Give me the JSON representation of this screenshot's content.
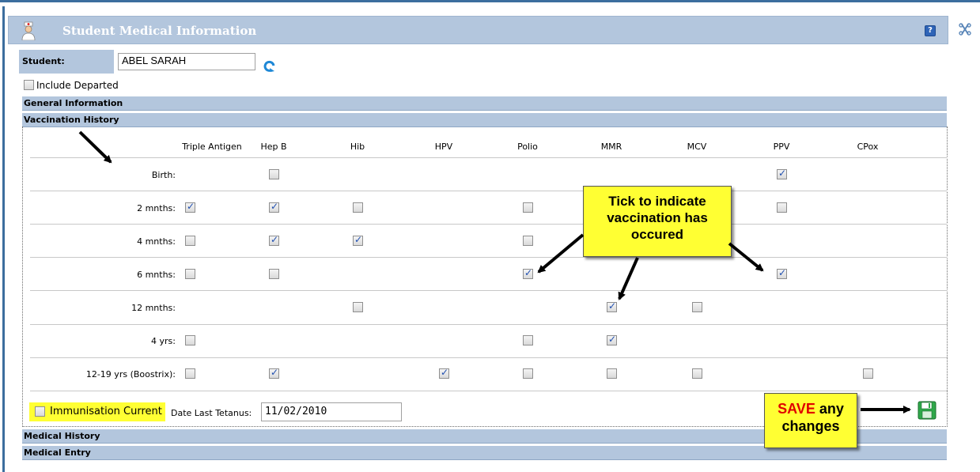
{
  "window": {
    "title": "Student Medical Information",
    "help_label": "?"
  },
  "student": {
    "label": "Student:",
    "value": "ABEL SARAH"
  },
  "include_departed": {
    "label": "Include Departed",
    "checked": false
  },
  "sections": {
    "general": "General Information",
    "vaccination": "Vaccination History",
    "medical_history": "Medical History",
    "medical_entry": "Medical Entry"
  },
  "columns": [
    "Triple Antigen",
    "Hep B",
    "Hib",
    "HPV",
    "Polio",
    "MMR",
    "MCV",
    "PPV",
    "CPox"
  ],
  "rows": [
    {
      "label": "Birth:",
      "cells": [
        null,
        false,
        null,
        null,
        null,
        null,
        null,
        true,
        null
      ]
    },
    {
      "label": "2 mnths:",
      "cells": [
        true,
        true,
        false,
        null,
        false,
        null,
        null,
        false,
        null
      ]
    },
    {
      "label": "4 mnths:",
      "cells": [
        false,
        true,
        true,
        null,
        false,
        null,
        null,
        null,
        null
      ]
    },
    {
      "label": "6 mnths:",
      "cells": [
        false,
        false,
        null,
        null,
        true,
        null,
        null,
        true,
        null
      ]
    },
    {
      "label": "12 mnths:",
      "cells": [
        null,
        null,
        false,
        null,
        null,
        true,
        false,
        null,
        null
      ]
    },
    {
      "label": "4 yrs:",
      "cells": [
        false,
        null,
        null,
        null,
        false,
        true,
        null,
        null,
        null
      ]
    },
    {
      "label": "12-19 yrs (Boostrix):",
      "cells": [
        false,
        true,
        null,
        true,
        false,
        false,
        false,
        null,
        false
      ]
    }
  ],
  "immunisation_current": {
    "label": "Immunisation Current",
    "checked": false
  },
  "tetanus": {
    "label": "Date Last Tetanus:",
    "value": "11/02/2010"
  },
  "callouts": {
    "tick": [
      "Tick to indicate",
      "vaccination has",
      "occured"
    ],
    "save_word": "SAVE",
    "save_rest": " any",
    "save_line2": "changes"
  },
  "colors": {
    "header_bg": "#b3c6dd",
    "highlight": "#ffff33",
    "accent": "#3c6e9e"
  }
}
